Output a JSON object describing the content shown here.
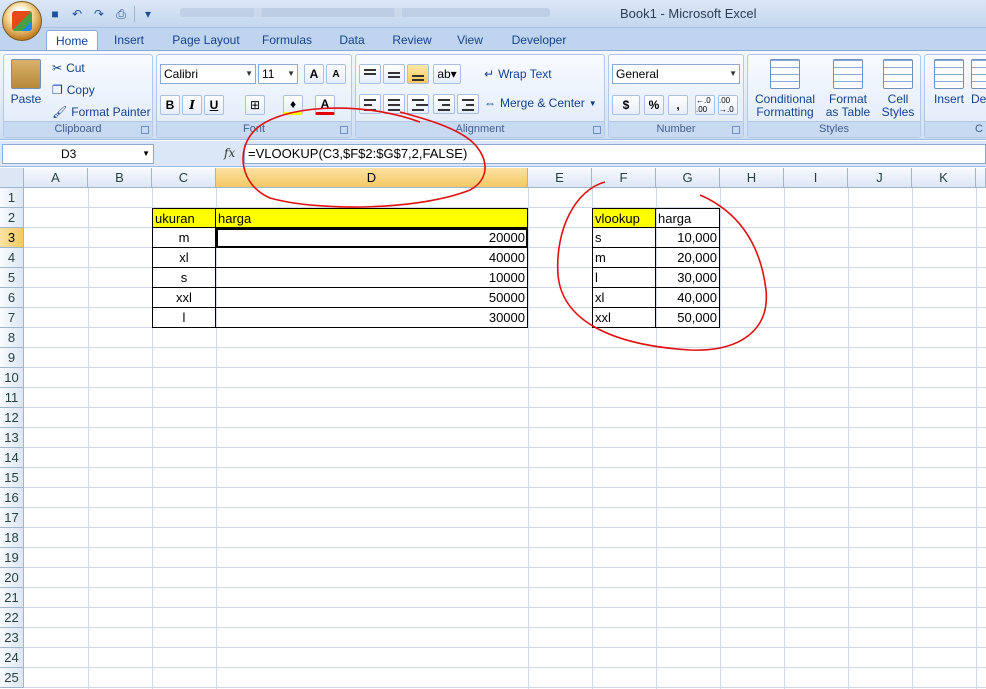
{
  "title_bar": {
    "app_title": "Book1 - Microsoft Excel"
  },
  "tabs": [
    "Home",
    "Insert",
    "Page Layout",
    "Formulas",
    "Data",
    "Review",
    "View",
    "Developer"
  ],
  "clipboard": {
    "paste": "Paste",
    "cut": "Cut",
    "copy": "Copy",
    "format_painter": "Format Painter",
    "label": "Clipboard"
  },
  "font": {
    "name": "Calibri",
    "size": "11",
    "bold": "B",
    "italic": "I",
    "underline": "U",
    "grow": "A",
    "shrink": "A",
    "color_letter": "A",
    "label": "Font"
  },
  "alignment": {
    "wrap": "Wrap Text",
    "merge": "Merge & Center",
    "label": "Alignment"
  },
  "number": {
    "format": "General",
    "currency": "$",
    "percent": "%",
    "comma": ",",
    "inc": "←.0 .00",
    "dec": ".00 →.0",
    "label": "Number"
  },
  "styles": {
    "conditional": [
      "Conditional",
      "Formatting"
    ],
    "table": [
      "Format",
      "as Table"
    ],
    "cell": [
      "Cell",
      "Styles"
    ],
    "label": "Styles"
  },
  "cells": {
    "insert": "Insert",
    "delete": "De",
    "label": "C"
  },
  "formula_bar": {
    "name_box": "D3",
    "fx": "fx",
    "formula": "=VLOOKUP(C3,$F$2:$G$7,2,FALSE)"
  },
  "columns": [
    "A",
    "B",
    "C",
    "D",
    "E",
    "F",
    "G",
    "H",
    "I",
    "J",
    "K"
  ],
  "rows": [
    "1",
    "2",
    "3",
    "4",
    "5",
    "6",
    "7",
    "8",
    "9",
    "10",
    "11",
    "12",
    "13",
    "14",
    "15",
    "16",
    "17",
    "18",
    "19",
    "20",
    "21",
    "22",
    "23",
    "24",
    "25"
  ],
  "table1": {
    "header": {
      "c": "ukuran",
      "d": "harga"
    },
    "rows": [
      {
        "c": "m",
        "d": "20000"
      },
      {
        "c": "xl",
        "d": "40000"
      },
      {
        "c": "s",
        "d": "10000"
      },
      {
        "c": "xxl",
        "d": "50000"
      },
      {
        "c": "l",
        "d": "30000"
      }
    ]
  },
  "table2": {
    "header": {
      "f": "vlookup",
      "g": "harga"
    },
    "rows": [
      {
        "f": "s",
        "g": "10,000"
      },
      {
        "f": "m",
        "g": "20,000"
      },
      {
        "f": "l",
        "g": "30,000"
      },
      {
        "f": "xl",
        "g": "40,000"
      },
      {
        "f": "xxl",
        "g": "50,000"
      }
    ]
  },
  "colors": {
    "highlight": "#ffff00",
    "annotation": "#e01010"
  }
}
